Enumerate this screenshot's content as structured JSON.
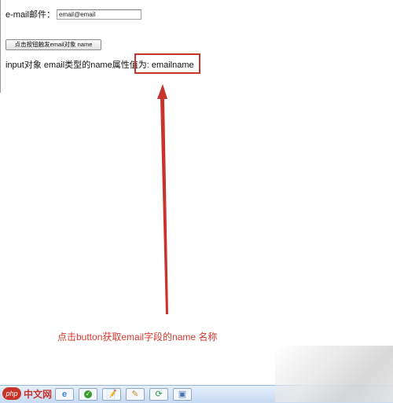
{
  "form": {
    "email_label": "e-mail邮件：",
    "email_value": "email@email",
    "button_label": "点击按钮触发email对象 name"
  },
  "result": {
    "text": "input对象 email类型的name属性值为: emailname"
  },
  "annotation": {
    "caption": "点击button获取email字段的name 名称",
    "color": "#c8332b"
  },
  "taskbar": {
    "icons": [
      "ie-icon",
      "check-icon",
      "notepad-icon",
      "paint-icon",
      "refresh-icon",
      "app-icon"
    ]
  },
  "watermark": {
    "badge": "php",
    "site": "中文网"
  }
}
